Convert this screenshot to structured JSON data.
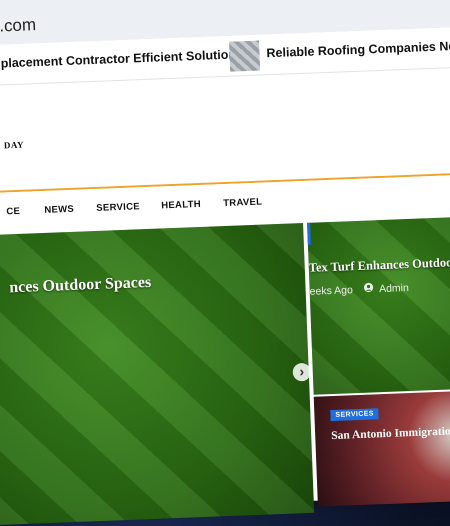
{
  "browser": {
    "url": ".com"
  },
  "ticker": {
    "item1": "placement Contractor Efficient Solutions",
    "item2": "Reliable Roofing Companies Near M"
  },
  "site": {
    "logo_text": "DAY"
  },
  "nav": {
    "items": [
      "CE",
      "NEWS",
      "SERVICE",
      "HEALTH",
      "TRAVEL"
    ]
  },
  "hero": {
    "title": "nces Outdoor Spaces",
    "next_icon": "chevron-right-icon"
  },
  "side_card_1": {
    "title": "Tex Turf Enhances Outdoor S",
    "time": "eeks Ago",
    "author": "Admin",
    "author_icon": "user-icon"
  },
  "side_card_2": {
    "badge": "SERVICES",
    "title": "San Antonio Immigration"
  },
  "colors": {
    "accent": "#f0a32a",
    "badge": "#1e6fe0"
  }
}
